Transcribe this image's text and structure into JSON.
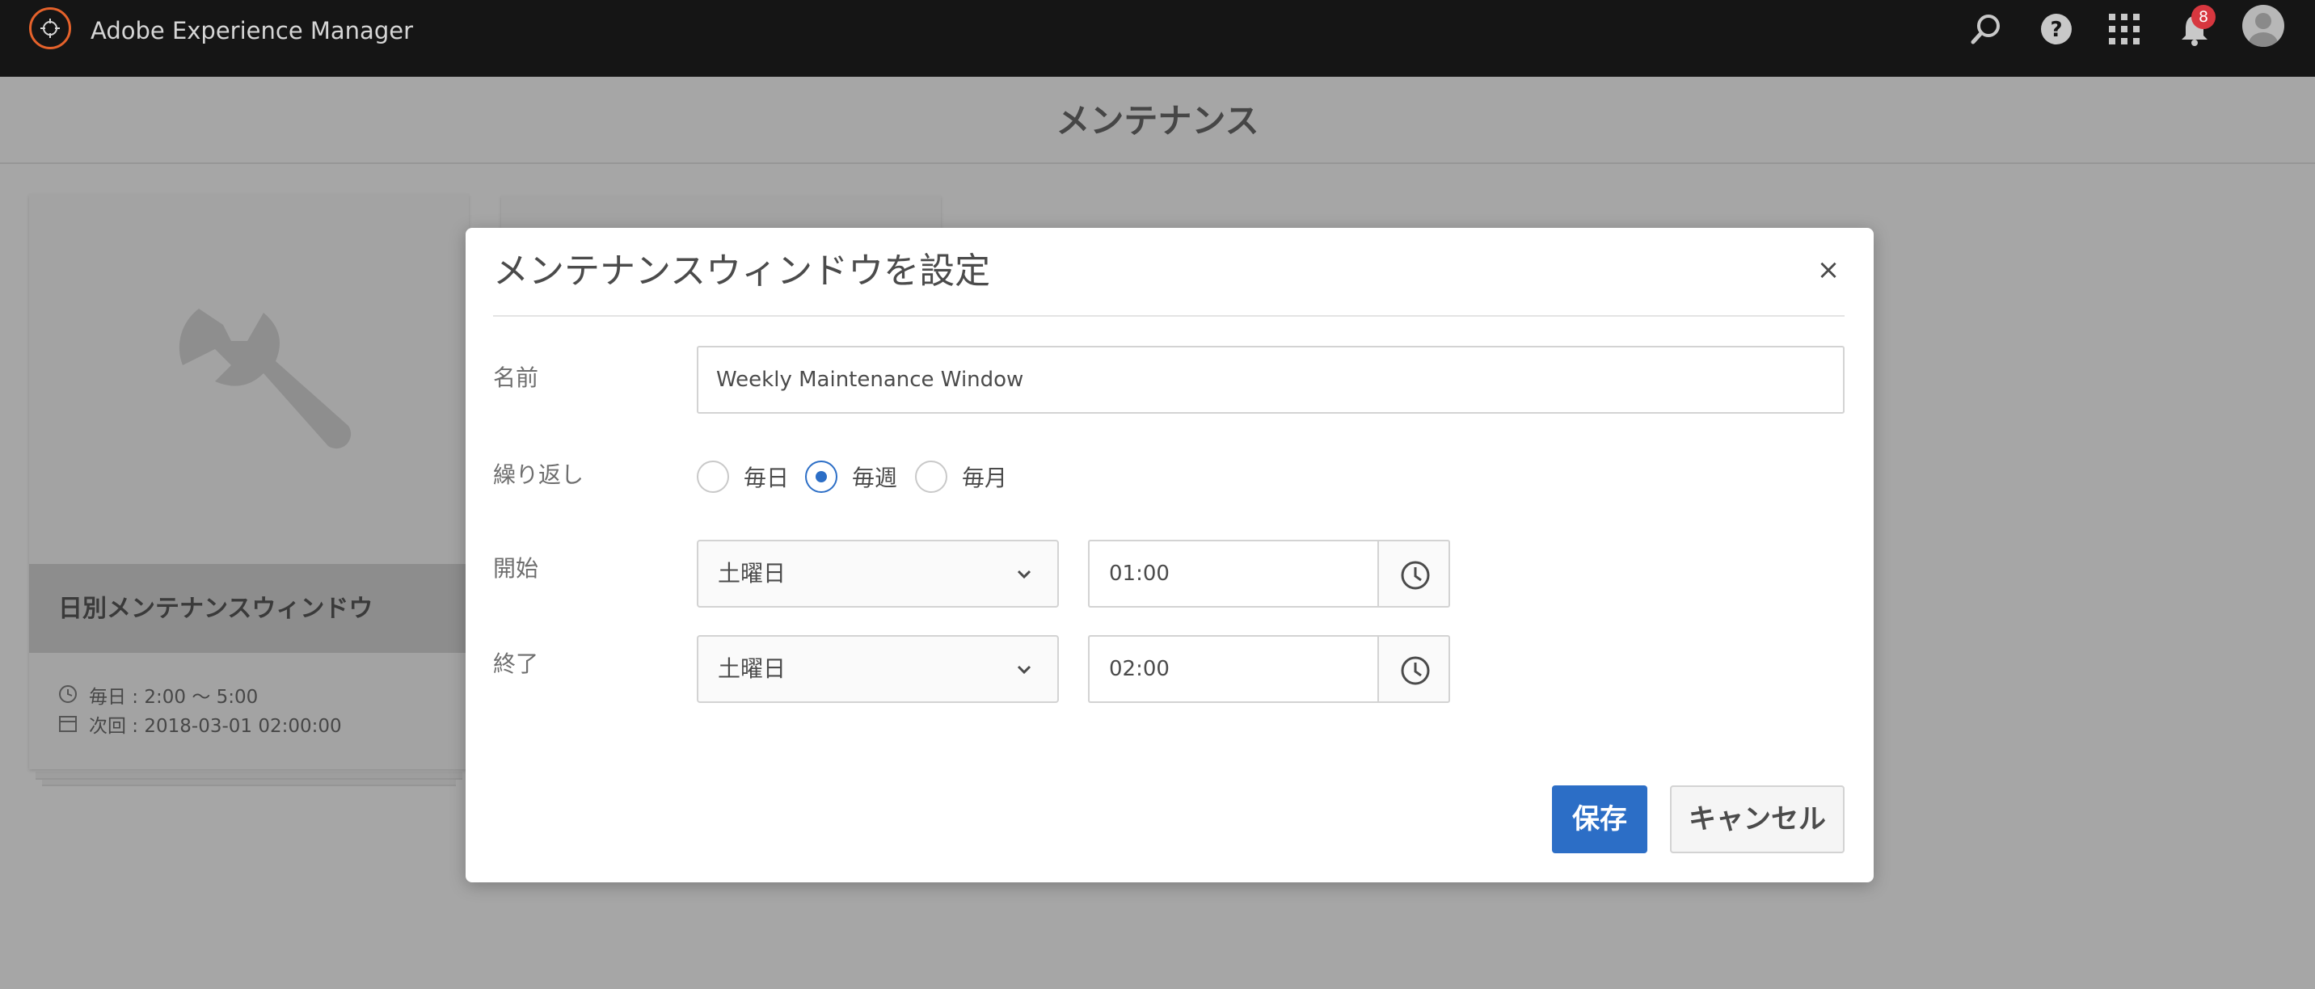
{
  "topbar": {
    "app_title": "Adobe Experience Manager",
    "icons": [
      "search-icon",
      "help-icon",
      "apps-grid-icon",
      "bell-icon",
      "user-avatar-icon"
    ],
    "notification_count": "8"
  },
  "page": {
    "title": "メンテナンス"
  },
  "card": {
    "title": "日別メンテナンスウィンドウ",
    "schedule": "毎日 : 2:00 〜 5:00",
    "next_run": "次回 : 2018-03-01 02:00:00"
  },
  "dialog": {
    "title": "メンテナンスウィンドウを設定",
    "close_label": "×",
    "name": {
      "label": "名前",
      "value": "Weekly Maintenance Window"
    },
    "recurrence": {
      "label": "繰り返し",
      "options": [
        {
          "label": "毎日",
          "selected": false
        },
        {
          "label": "毎週",
          "selected": true
        },
        {
          "label": "毎月",
          "selected": false
        }
      ]
    },
    "start": {
      "label": "開始",
      "day": "土曜日",
      "time": "01:00"
    },
    "end": {
      "label": "終了",
      "day": "土曜日",
      "time": "02:00"
    },
    "save_label": "保存",
    "cancel_label": "キャンセル"
  },
  "colors": {
    "accent": "#2c6ec6",
    "topbar_bg": "#151515",
    "overlay_bg": "#a6a6a6",
    "badge": "#d7373f",
    "logo": "#e5622b"
  }
}
